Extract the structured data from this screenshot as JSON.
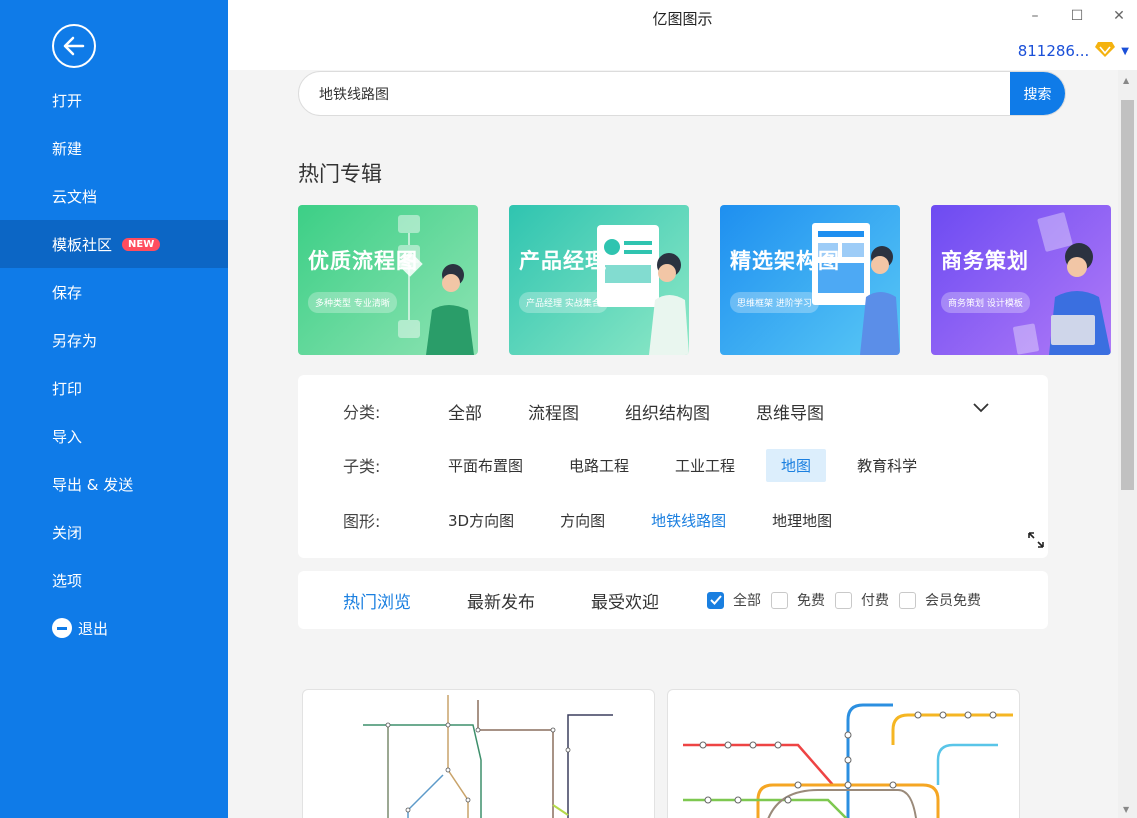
{
  "window": {
    "title": "亿图图示",
    "minimize_glyph": "–",
    "maximize_glyph": "☐",
    "close_glyph": "✕",
    "user_id": "811286...",
    "vip_icon": "diamond-icon"
  },
  "sidebar": {
    "items": [
      {
        "label": "打开"
      },
      {
        "label": "新建"
      },
      {
        "label": "云文档"
      },
      {
        "label": "模板社区",
        "badge": "NEW",
        "active": true
      },
      {
        "label": "保存"
      },
      {
        "label": "另存为"
      },
      {
        "label": "打印"
      },
      {
        "label": "导入"
      },
      {
        "label": "导出 & 发送"
      },
      {
        "label": "关闭"
      },
      {
        "label": "选项"
      },
      {
        "label": "退出"
      }
    ]
  },
  "search": {
    "value": "地铁线路图",
    "button_label": "搜索"
  },
  "featured": {
    "title": "热门专辑",
    "banners": [
      {
        "title": "优质流程图",
        "subtitle": "多种类型 专业清晰",
        "color_from": "#3ccf86",
        "color_to": "#8ee3b3"
      },
      {
        "title": "产品经理",
        "subtitle": "产品经理 实战集合",
        "color_from": "#2fc4b0",
        "color_to": "#8de8c6"
      },
      {
        "title": "精选架构图",
        "subtitle": "思维框架 进阶学习",
        "color_from": "#1e8ff0",
        "color_to": "#59c8f5"
      },
      {
        "title": "商务策划",
        "subtitle": "商务策划 设计模板",
        "color_from": "#6d4bf2",
        "color_to": "#b07af7"
      }
    ]
  },
  "filters": {
    "category_label": "分类:",
    "categories": [
      "全部",
      "流程图",
      "组织结构图",
      "思维导图"
    ],
    "subcategory_label": "子类:",
    "subcategories": [
      "平面布置图",
      "电路工程",
      "工业工程",
      "地图",
      "教育科学"
    ],
    "selected_subcategory": "地图",
    "shape_label": "图形:",
    "shapes": [
      "3D方向图",
      "方向图",
      "地铁线路图",
      "地理地图"
    ],
    "selected_shape": "地铁线路图"
  },
  "sort": {
    "tabs": [
      "热门浏览",
      "最新发布",
      "最受欢迎"
    ],
    "active_tab": "热门浏览",
    "checks": [
      {
        "label": "全部",
        "checked": true
      },
      {
        "label": "免费",
        "checked": false
      },
      {
        "label": "付费",
        "checked": false
      },
      {
        "label": "会员免费",
        "checked": false
      }
    ]
  },
  "colors": {
    "accent": "#0f7be8",
    "sidebar_active": "#0c66c5",
    "badge": "#ff4d5e",
    "link": "#1a7fe0"
  }
}
